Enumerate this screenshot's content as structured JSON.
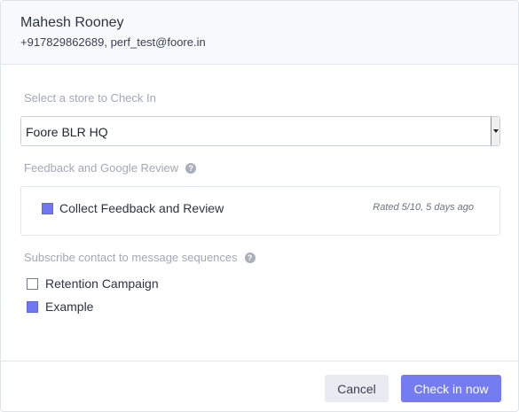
{
  "contact": {
    "name": "Mahesh Rooney",
    "details": "+917829862689, perf_test@foore.in"
  },
  "store": {
    "label": "Select a store to Check In",
    "selected": "Foore BLR HQ"
  },
  "feedback": {
    "label": "Feedback and Google Review",
    "help_icon": "question-circle-icon",
    "option_label": "Collect Feedback and Review",
    "option_checked": true,
    "meta": "Rated 5/10, 5 days ago"
  },
  "sequences": {
    "label": "Subscribe contact to message sequences",
    "help_icon": "question-circle-icon",
    "items": [
      {
        "label": "Retention Campaign",
        "checked": false
      },
      {
        "label": "Example",
        "checked": true
      }
    ]
  },
  "footer": {
    "cancel_label": "Cancel",
    "primary_label": "Check in now"
  },
  "colors": {
    "accent": "#757bf1",
    "header_bg": "#f7f9fc",
    "muted_text": "#a2a8b4"
  }
}
